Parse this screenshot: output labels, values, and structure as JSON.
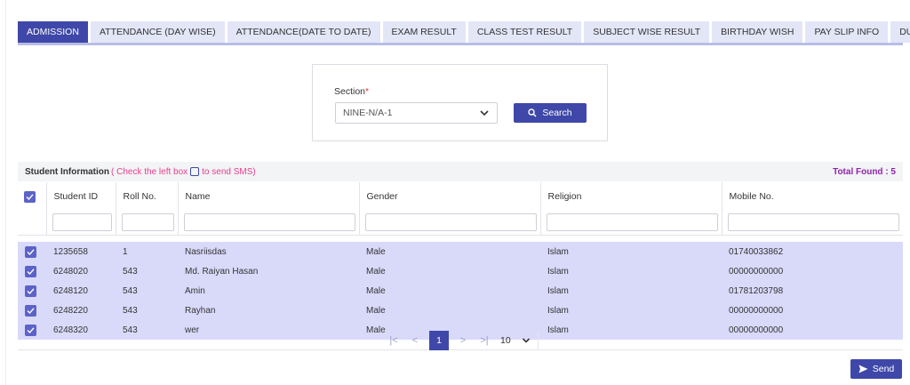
{
  "tabs": [
    {
      "label": "ADMISSION",
      "active": true
    },
    {
      "label": "ATTENDANCE (DAY WISE)"
    },
    {
      "label": "ATTENDANCE(DATE TO DATE)"
    },
    {
      "label": "EXAM RESULT"
    },
    {
      "label": "CLASS TEST RESULT"
    },
    {
      "label": "SUBJECT WISE RESULT"
    },
    {
      "label": "BIRTHDAY WISH"
    },
    {
      "label": "PAY SLIP INFO"
    },
    {
      "label": "DUE INFO"
    }
  ],
  "filter": {
    "section_label": "Section",
    "required_mark": "*",
    "section_value": "NINE-N/A-1",
    "search_label": "Search"
  },
  "student_info": {
    "title": "Student Information",
    "hint_before": "( Check the left box",
    "hint_after": "to send SMS)",
    "total_found": "Total Found : 5"
  },
  "table": {
    "columns": [
      "Student ID",
      "Roll No.",
      "Name",
      "Gender",
      "Religion",
      "Mobile No."
    ],
    "rows": [
      [
        "1235658",
        "1",
        "Nasriisdas",
        "Male",
        "Islam",
        "01740033862"
      ],
      [
        "6248020",
        "543",
        "Md. Raiyan Hasan",
        "Male",
        "Islam",
        "00000000000"
      ],
      [
        "6248120",
        "543",
        "Amin",
        "Male",
        "Islam",
        "01781203798"
      ],
      [
        "6248220",
        "543",
        "Rayhan",
        "Male",
        "Islam",
        "00000000000"
      ],
      [
        "6248320",
        "543",
        "wer",
        "Male",
        "Islam",
        "00000000000"
      ]
    ]
  },
  "pagination": {
    "first": "|<",
    "prev": "<",
    "current": "1",
    "next": ">",
    "last": ">|",
    "page_size": "10"
  },
  "send_label": "Send",
  "colors": {
    "primary": "#3f48a8",
    "row_selected": "#d9dafa",
    "hint": "#e83e8c",
    "total": "#8e24aa"
  }
}
